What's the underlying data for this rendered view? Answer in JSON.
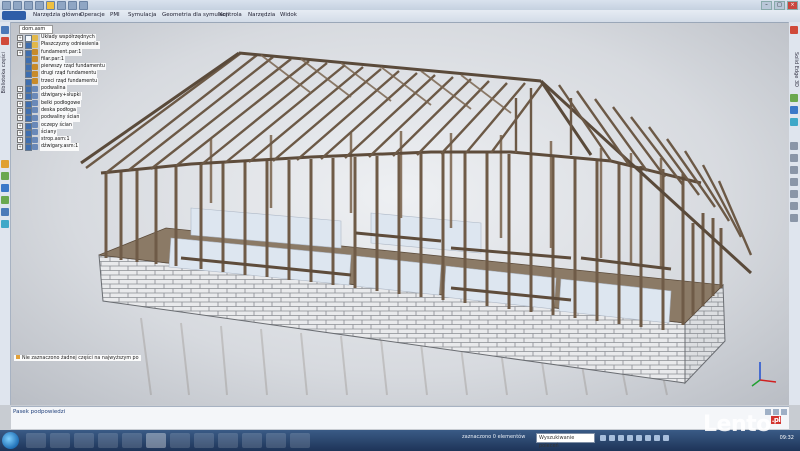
{
  "menu": {
    "items": [
      "Narzędzia główne",
      "Operacje",
      "PMI",
      "Symulacja",
      "Geometria dla symulacji",
      "Kontrola",
      "Narzędzia",
      "Widok"
    ]
  },
  "sidebar_left": {
    "tab_label": "Biblioteka części"
  },
  "sidebar_right": {
    "tab_label": "Solid Edge 3D"
  },
  "tree": {
    "root": "dom.asm",
    "items": [
      {
        "label": "Układy współrzędnych",
        "expander": "+",
        "checked": false,
        "icon": "folder"
      },
      {
        "label": "Płaszczyzny odniesienia",
        "expander": "+",
        "checked": true,
        "icon": "folder"
      },
      {
        "label": "fundament.par:1",
        "expander": "+",
        "checked": true,
        "icon": "part"
      },
      {
        "label": "filar.par:1",
        "expander": "",
        "checked": true,
        "icon": "part"
      },
      {
        "label": "pierwszy rząd fundamentu",
        "expander": "",
        "checked": true,
        "icon": "part"
      },
      {
        "label": "drugi rząd fundamentu",
        "expander": "",
        "checked": true,
        "icon": "part"
      },
      {
        "label": "trzeci rząd fundamentu",
        "expander": "",
        "checked": true,
        "icon": "part"
      },
      {
        "label": "podwalina",
        "expander": "+",
        "checked": true,
        "icon": "asm"
      },
      {
        "label": "dźwigary+słupki",
        "expander": "+",
        "checked": true,
        "icon": "asm"
      },
      {
        "label": "belki podłogowe",
        "expander": "+",
        "checked": true,
        "icon": "asm"
      },
      {
        "label": "deska podłoga",
        "expander": "+",
        "checked": true,
        "icon": "asm"
      },
      {
        "label": "podwaliny ścian",
        "expander": "+",
        "checked": true,
        "icon": "asm"
      },
      {
        "label": "oczepy ścian",
        "expander": "+",
        "checked": true,
        "icon": "asm"
      },
      {
        "label": "ściany",
        "expander": "+",
        "checked": true,
        "icon": "asm"
      },
      {
        "label": "strop.asm:1",
        "expander": "+",
        "checked": true,
        "icon": "asm"
      },
      {
        "label": "dźwigary.asm:1",
        "expander": "+",
        "checked": true,
        "icon": "asm"
      }
    ]
  },
  "viewport": {
    "status_message": "Nie zaznaczono żadnej części na najwyższym po"
  },
  "hint_bar": {
    "label": "Pasek podpowiedzi"
  },
  "taskbar": {
    "selection_count": "zaznaczono 0 elementów",
    "search_value": "Wyszukiwanie poleceń",
    "clock": "09:32"
  },
  "watermark": {
    "text": "Lento",
    "tld": ".pl"
  }
}
